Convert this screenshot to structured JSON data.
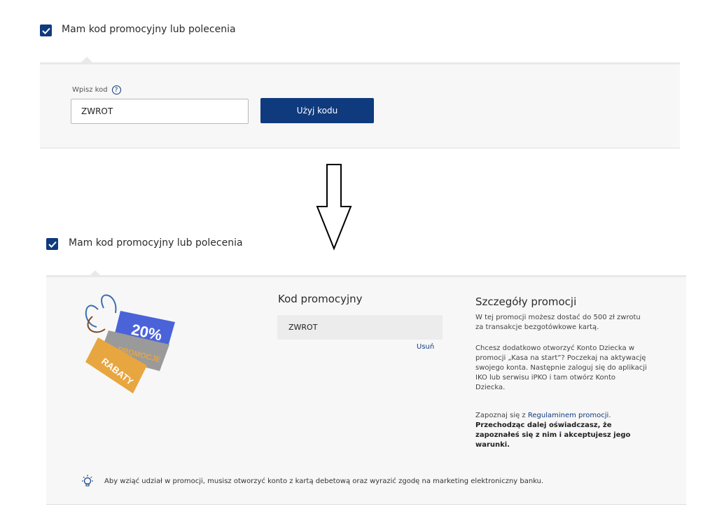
{
  "before": {
    "checkbox_label": "Mam kod promocyjny lub polecenia",
    "code_label": "Wpisz kod",
    "code_value": "ZWROT",
    "submit_label": "Użyj kodu"
  },
  "after": {
    "checkbox_label": "Mam kod promocyjny lub polecenia",
    "promo_image": {
      "badge_text": "20%",
      "tag_text_1": "PROMOCJE",
      "tag_text_2": "RABATY"
    },
    "promo_code_heading": "Kod promocyjny",
    "promo_code_value": "ZWROT",
    "remove_label": "Usuń",
    "details_heading": "Szczegóły promocji",
    "details_p1": "W tej promocji możesz dostać do 500 zł zwrotu za transakcje bezgotówkowe kartą.",
    "details_p2": "Chcesz dodatkowo otworzyć Konto Dziecka w promocji „Kasa na start”? Poczekaj na aktywację swojego konta. Następnie zaloguj się do aplikacji IKO lub serwisu iPKO i tam otwórz Konto Dziecka.",
    "details_p3_prefix": "Zapoznaj się z ",
    "details_p3_link": "Regulaminem promocji",
    "details_p3_suffix": ".",
    "details_p3_bold": "Przechodząc dalej oświadczasz, że zapoznałeś się z nim i akceptujesz jego warunki.",
    "info_text": "Aby wziąć udział w promocji, musisz otworzyć konto z kartą debetową oraz wyrazić zgodę na marketing elektroniczny banku."
  },
  "colors": {
    "brand_navy": "#0f3a7e",
    "panel_bg": "#f7f7f7"
  }
}
